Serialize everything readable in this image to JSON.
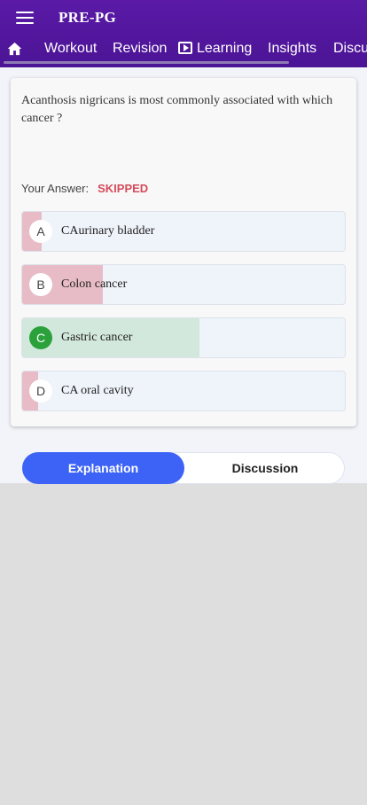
{
  "app": {
    "title": "PRE-PG"
  },
  "tabs": [
    {
      "label": "Workout"
    },
    {
      "label": "Revision"
    },
    {
      "label": "Learning"
    },
    {
      "label": "Insights"
    },
    {
      "label": "Discussion"
    }
  ],
  "question": {
    "text": "Acanthosis nigricans is most commonly associated with which cancer ?",
    "answer_label": "Your Answer:",
    "answer_value": "SKIPPED"
  },
  "options": [
    {
      "letter": "A",
      "text": "CAurinary bladder",
      "response_share": 0.06,
      "fill_color": "#e8bcc6",
      "correct": false
    },
    {
      "letter": "B",
      "text": "Colon cancer",
      "response_share": 0.25,
      "fill_color": "#e8bcc6",
      "correct": false
    },
    {
      "letter": "C",
      "text": "Gastric cancer",
      "response_share": 0.55,
      "fill_color": "#d3e8dc",
      "correct": true
    },
    {
      "letter": "D",
      "text": "CA oral cavity",
      "response_share": 0.05,
      "fill_color": "#e8bcc6",
      "correct": false
    }
  ],
  "toggle": {
    "explanation": "Explanation",
    "discussion": "Discussion"
  },
  "colors": {
    "appbar": "#5a1aa6",
    "accent": "#3c63f6",
    "correct": "#2aa13b",
    "skipped": "#d54b5b"
  }
}
